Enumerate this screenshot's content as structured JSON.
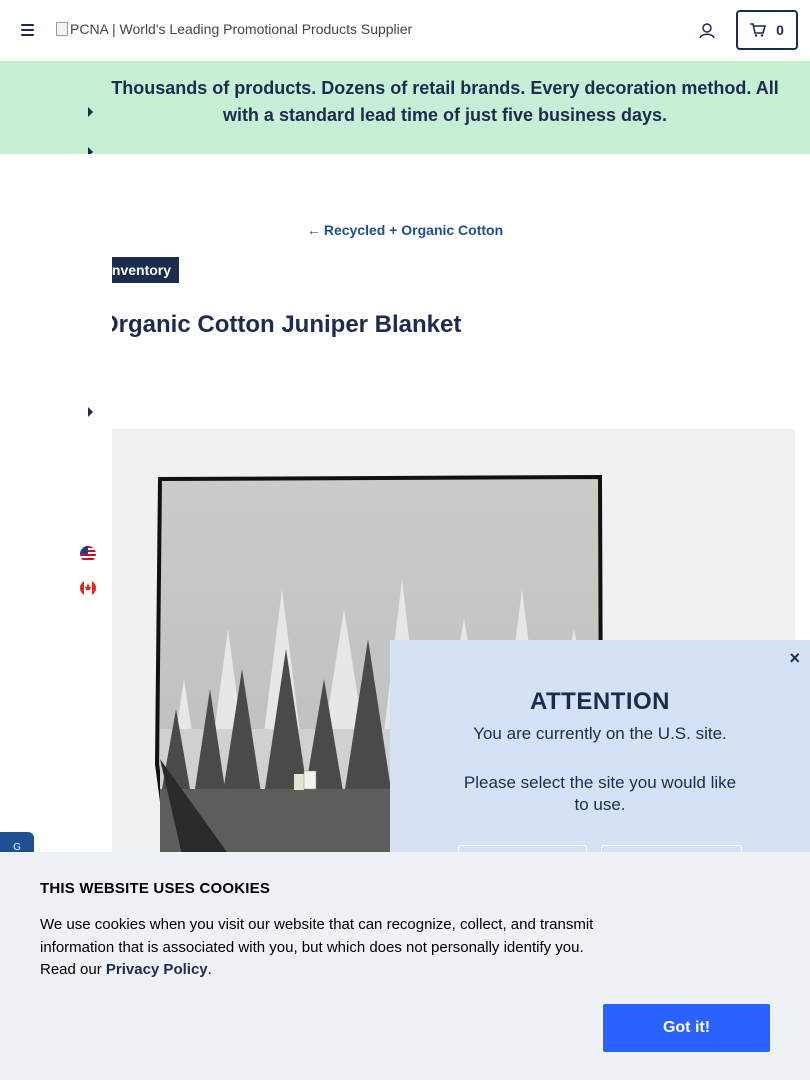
{
  "header": {
    "logo_alt": "PCNA | World's Leading Promotional Products Supplier",
    "cart_count": "0"
  },
  "banner": {
    "text": "Thousands of products. Dozens of retail brands. Every decoration method. All with a standard lead time of just five business days."
  },
  "product": {
    "back_link": "Recycled + Organic Cotton",
    "tag": "Inventory",
    "title": "Organic Cotton Juniper Blanket"
  },
  "modal": {
    "close": "×",
    "title": "ATTENTION",
    "subtitle": "You are currently on the U.S. site.",
    "prompt": "Please select the site you would like to use."
  },
  "cookie": {
    "title": "THIS WEBSITE USES COOKIES",
    "text": "We use cookies when you visit our website that can recognize, collect, and transmit information that is associated with you, but which does not personally identify you. Read our",
    "link": "Privacy Policy",
    "period": ".",
    "button": "Got it!"
  },
  "feedback": {
    "label": "G"
  },
  "colors": {
    "navy": "#1d2b4e",
    "banner": "#c6efd6",
    "modal": "#d5e2f5",
    "accept": "#2962ff"
  }
}
